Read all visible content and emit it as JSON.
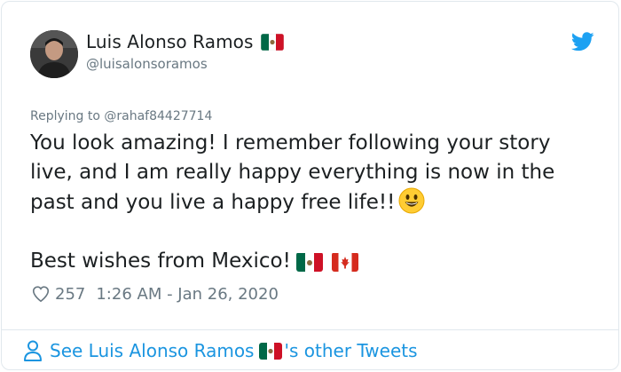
{
  "tweet": {
    "author": {
      "display_name": "Luis Alonso Ramos",
      "handle": "@luisalonsoramos",
      "flag": "mexico-flag",
      "avatar": "avatar"
    },
    "brand_icon": "twitter-bird-icon",
    "reply_to": "Replying to @rahaf84427714",
    "body_line_1": "You look amazing! I remember following your story live, and I am really happy everything is now in the past and you live a happy free life!!",
    "body_emoji": "grinning-face-emoji",
    "body_line_2": "Best wishes from Mexico!",
    "body_flags": [
      "mexico-flag",
      "canada-flag"
    ],
    "likes": "257",
    "timestamp": "1:26 AM - Jan 26, 2020",
    "footer_prefix": "See Luis Alonso Ramos",
    "footer_suffix": "'s other Tweets"
  },
  "colors": {
    "text": "#1c2022",
    "muted": "#697882",
    "link": "#1b95e0",
    "border": "#e1e8ed",
    "twitter_blue": "#1da1f2"
  }
}
